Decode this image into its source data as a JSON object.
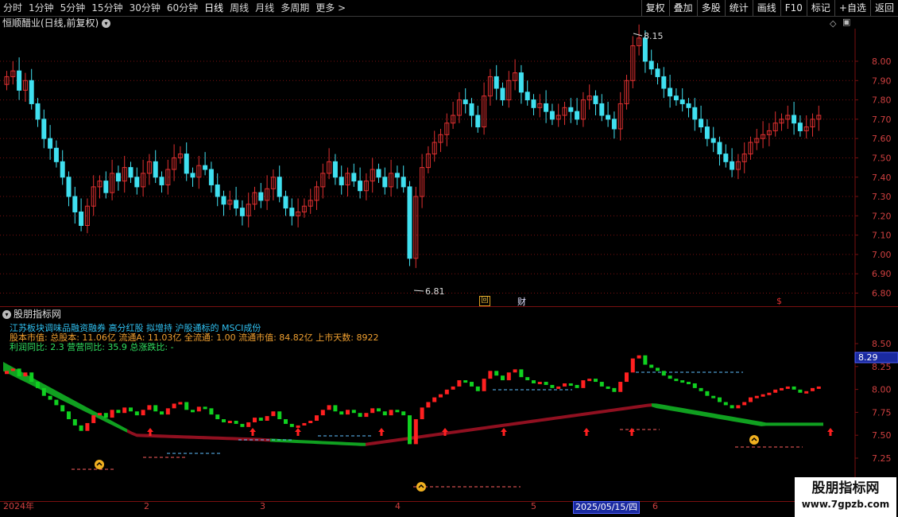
{
  "toolbar": {
    "periods": [
      "分时",
      "1分钟",
      "5分钟",
      "15分钟",
      "30分钟",
      "60分钟",
      "日线",
      "周线",
      "月线",
      "多周期",
      "更多 >"
    ],
    "buttons": [
      "复权",
      "叠加",
      "多股",
      "统计",
      "画线",
      "F10",
      "标记",
      "+自选",
      "返回"
    ]
  },
  "main_panel": {
    "title": "恒顺醋业(日线,前复权)",
    "high_label": "8.15",
    "low_label": "6.81",
    "markers": [
      "回",
      "财",
      "$"
    ],
    "y_ticks": [
      "8.00",
      "7.90",
      "7.80",
      "7.70",
      "7.60",
      "7.50",
      "7.40",
      "7.30",
      "7.20",
      "7.10",
      "7.00",
      "6.90",
      "6.80"
    ]
  },
  "sub_panel": {
    "title": "股朋指标网",
    "info_line1": "江苏板块调味品融资融券 高分红股 拟增持 沪股通标的 MSCI成份",
    "info_line2": "股本市值: 总股本: 11.06亿 流通A: 11.03亿 全流通: 1.00 流通市值: 84.82亿 上市天数: 8922",
    "info_line3a": "利润同比: 2.3",
    "info_line3b": "营营同比: 35.9",
    "info_line3c": "总涨跌比: -",
    "current_value": "8.29",
    "y_ticks": [
      "8.50",
      "8.25",
      "8.00",
      "7.75",
      "7.50",
      "7.25"
    ]
  },
  "date_axis": {
    "labels": [
      "2024年",
      "2",
      "3",
      "4",
      "5",
      "6"
    ],
    "current_date": "2025/05/15/四"
  },
  "watermark": {
    "title": "股朋指标网",
    "url": "www.7gpzb.com"
  },
  "colors": {
    "up": "#e03030",
    "down": "#40e0f0",
    "grid": "#7a1010",
    "band_green": "#10a020",
    "band_red": "#901020",
    "sub_up": "#ff2020",
    "sub_down": "#10d020"
  }
}
